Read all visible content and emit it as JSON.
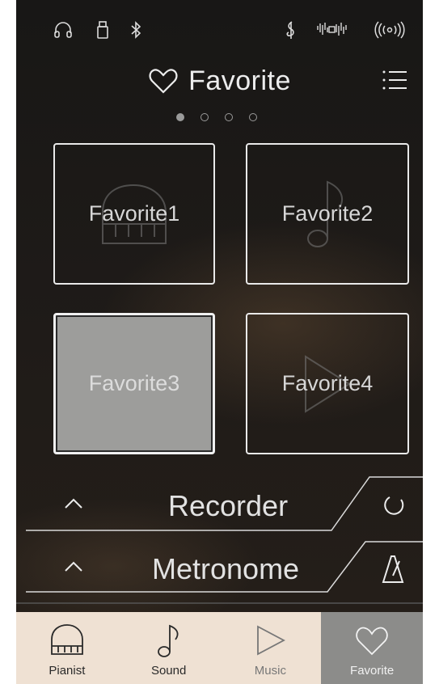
{
  "status_bar": {
    "icons": [
      "headphones-icon",
      "usb-icon",
      "bluetooth-icon",
      "clef-icon",
      "sound-wave-icon",
      "wireless-icon"
    ]
  },
  "header": {
    "title": "Favorite",
    "icon": "heart-icon",
    "menu_icon": "list-menu-icon"
  },
  "pager": {
    "count": 4,
    "active_index": 0
  },
  "favorites": [
    {
      "label": "Favorite1",
      "ghost_icon": "piano-icon",
      "selected": false
    },
    {
      "label": "Favorite2",
      "ghost_icon": "music-note-icon",
      "selected": false
    },
    {
      "label": "Favorite3",
      "ghost_icon": "",
      "selected": true
    },
    {
      "label": "Favorite4",
      "ghost_icon": "play-icon",
      "selected": false
    }
  ],
  "recorder": {
    "title": "Recorder",
    "expand_icon": "chevron-up-icon",
    "button_icon": "record-circle-icon"
  },
  "metronome": {
    "title": "Metronome",
    "expand_icon": "chevron-up-icon",
    "button_icon": "metronome-icon"
  },
  "tabbar": {
    "tabs": [
      {
        "label": "Pianist",
        "icon": "piano-icon"
      },
      {
        "label": "Sound",
        "icon": "music-note-icon"
      },
      {
        "label": "Music",
        "icon": "play-icon"
      },
      {
        "label": "Favorite",
        "icon": "heart-icon"
      }
    ],
    "active_index": 3
  },
  "colors": {
    "background": "#1c1917",
    "tile_border": "#e9e9e9",
    "selected_tile": "#9d9d9b",
    "tabbar_bg": "#efe1d3",
    "active_tab": "#8c8c8a"
  }
}
